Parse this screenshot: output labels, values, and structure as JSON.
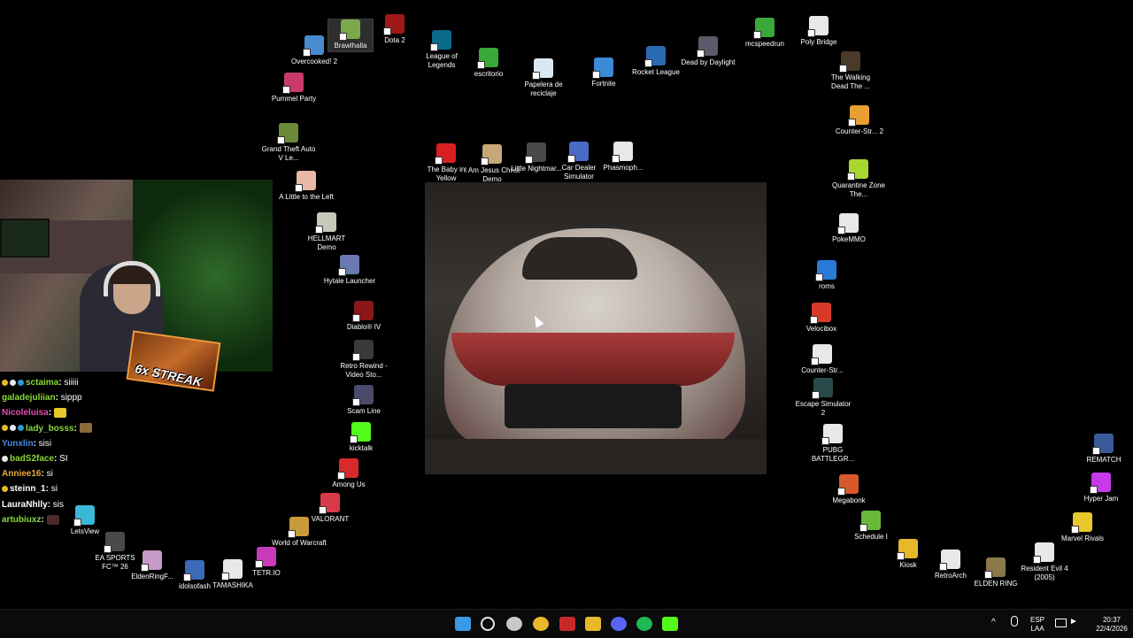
{
  "desktop_icons": [
    {
      "id": "overcooked",
      "label": "Overcooked! 2",
      "color": "#4a8bd0"
    },
    {
      "id": "brawlhalla",
      "label": "Brawlhalla",
      "color": "#7ba84a"
    },
    {
      "id": "dota2",
      "label": "Dota 2",
      "color": "#a01818"
    },
    {
      "id": "league",
      "label": "League of Legends",
      "color": "#0a6a8a"
    },
    {
      "id": "escritorio",
      "label": "escritorio",
      "color": "#3aa83a"
    },
    {
      "id": "papelera",
      "label": "Papelera de reciclaje",
      "color": "#d8e8f0"
    },
    {
      "id": "fortnite",
      "label": "Fortnite",
      "color": "#3a8ad8"
    },
    {
      "id": "rocket",
      "label": "Rocket League",
      "color": "#2a6ab0"
    },
    {
      "id": "dbd",
      "label": "Dead by Daylight",
      "color": "#5a5a6a"
    },
    {
      "id": "mcspeedrun",
      "label": "mcspeedrun",
      "color": "#3aa83a"
    },
    {
      "id": "polybridge",
      "label": "Poly Bridge",
      "color": "#e8e8e8"
    },
    {
      "id": "pummel",
      "label": "Pummel Party",
      "color": "#c83a6a"
    },
    {
      "id": "gta",
      "label": "Grand Theft Auto V Le...",
      "color": "#6a8a3a"
    },
    {
      "id": "walkingdead",
      "label": "The Walking Dead The ...",
      "color": "#4a3a2a"
    },
    {
      "id": "cs2",
      "label": "Counter-Str... 2",
      "color": "#e8a030"
    },
    {
      "id": "littleleft",
      "label": "A Little to the Left",
      "color": "#e8b8a8"
    },
    {
      "id": "babyyellow",
      "label": "The Baby in Yellow",
      "color": "#d82020"
    },
    {
      "id": "jesus",
      "label": "I Am Jesus Christ Demo",
      "color": "#c8a878"
    },
    {
      "id": "littlenightmares",
      "label": "Little Nightmar...",
      "color": "#4a4a4a"
    },
    {
      "id": "cardealer",
      "label": "Car Dealer Simulator",
      "color": "#4a6ac8"
    },
    {
      "id": "phasmo",
      "label": "Phasmoph...",
      "color": "#e8e8e8"
    },
    {
      "id": "quarantine",
      "label": "Quarantine Zone The...",
      "color": "#a8d830"
    },
    {
      "id": "hellmart",
      "label": "HELLMART Demo",
      "color": "#c8c8b8"
    },
    {
      "id": "pokemmo",
      "label": "PokeMMO",
      "color": "#e8e8e8"
    },
    {
      "id": "hytale",
      "label": "Hytale Launcher",
      "color": "#6a7ab0"
    },
    {
      "id": "roms",
      "label": "roms",
      "color": "#2a7ad8"
    },
    {
      "id": "diablo",
      "label": "Diablo® IV",
      "color": "#8a1818"
    },
    {
      "id": "velocibox",
      "label": "Velocibox",
      "color": "#d83a2a"
    },
    {
      "id": "retrorewind",
      "label": "Retro Rewind - Video Sto...",
      "color": "#3a3a3a"
    },
    {
      "id": "cs-go",
      "label": "Counter-Str...",
      "color": "#e8e8e8"
    },
    {
      "id": "escape",
      "label": "Escape Simulator 2",
      "color": "#2a4a4a"
    },
    {
      "id": "scamline",
      "label": "Scam Line",
      "color": "#4a4a6a"
    },
    {
      "id": "kicktalk",
      "label": "kicktalk",
      "color": "#53fc18"
    },
    {
      "id": "pubg",
      "label": "PUBG BATTLEGR...",
      "color": "#e8e8e8"
    },
    {
      "id": "rematch",
      "label": "REMATCH",
      "color": "#3a5a9a"
    },
    {
      "id": "amongus",
      "label": "Among Us",
      "color": "#d82a2a"
    },
    {
      "id": "megabonk",
      "label": "Megabonk",
      "color": "#d85a2a"
    },
    {
      "id": "hyperjam",
      "label": "Hyper Jam",
      "color": "#c83ae8"
    },
    {
      "id": "valorant",
      "label": "VALORANT",
      "color": "#d83a4a"
    },
    {
      "id": "schedule1",
      "label": "Schedule I",
      "color": "#6ab83a"
    },
    {
      "id": "marvel",
      "label": "Marvel Rivals",
      "color": "#e8c82a"
    },
    {
      "id": "letsview",
      "label": "LetsView",
      "color": "#3ab8d8"
    },
    {
      "id": "wow",
      "label": "World of Warcraft",
      "color": "#c89a3a"
    },
    {
      "id": "kiosk",
      "label": "Kiosk",
      "color": "#e8b82a"
    },
    {
      "id": "re4",
      "label": "Resident Evil 4 (2005)",
      "color": "#e8e8e8"
    },
    {
      "id": "fc26",
      "label": "EA SPORTS FC™ 26",
      "color": "#4a4a4a"
    },
    {
      "id": "tetrio",
      "label": "TETR.IO",
      "color": "#c83ab8"
    },
    {
      "id": "retroarch",
      "label": "RetroArch",
      "color": "#e8e8e8"
    },
    {
      "id": "eldenringf",
      "label": "EldenRingF...",
      "color": "#c89ac8"
    },
    {
      "id": "eldenring",
      "label": "ELDEN RING",
      "color": "#8a7a4a"
    },
    {
      "id": "idolsofash",
      "label": "idolsofash",
      "color": "#3a6ab8"
    },
    {
      "id": "tamashika",
      "label": "TAMASHIKA",
      "color": "#e8e8e8"
    }
  ],
  "overlay": {
    "streak_text": "6x STREAK"
  },
  "chat": [
    {
      "user": "sctaima",
      "msg": "siiiii",
      "color": "#8ad83a",
      "badges": [
        "#e8b82a",
        "#e8e8e8",
        "#2a9ad8"
      ]
    },
    {
      "user": "galadejuliian",
      "msg": "sippp",
      "color": "#8ad83a",
      "badges": []
    },
    {
      "user": "Nicoleluisa",
      "msg": "",
      "color": "#e84ab8",
      "badges": [],
      "emote": "#e8c82a"
    },
    {
      "user": "lady_bosss",
      "msg": "",
      "color": "#8ad83a",
      "badges": [
        "#e8b82a",
        "#e8e8e8",
        "#2a9ad8"
      ],
      "emote": "#8a6a3a"
    },
    {
      "user": "Yunxlin",
      "msg": "sisi",
      "color": "#4a8ae8",
      "badges": []
    },
    {
      "user": "badS2face",
      "msg": "SI",
      "color": "#8ad83a",
      "badges": [
        "#e8e8e8"
      ]
    },
    {
      "user": "Anniee16",
      "msg": "si",
      "color": "#e8a83a",
      "badges": []
    },
    {
      "user": "steinn_1",
      "msg": "si",
      "color": "#ffffff",
      "badges": [
        "#e8b82a"
      ]
    },
    {
      "user": "LauraNhlly",
      "msg": "sis",
      "color": "#ffffff",
      "badges": []
    },
    {
      "user": "artubiuxz",
      "msg": "",
      "color": "#8ad83a",
      "badges": [],
      "emote": "#4a2a2a"
    }
  ],
  "taskbar": {
    "buttons": [
      {
        "id": "start",
        "color": "#3a9ae8"
      },
      {
        "id": "search",
        "color": "#e8e8e8"
      },
      {
        "id": "obs",
        "color": "#c8c8c8"
      },
      {
        "id": "chrome",
        "color": "#e8b82a"
      },
      {
        "id": "studio",
        "color": "#c82a2a"
      },
      {
        "id": "explorer",
        "color": "#e8b82a"
      },
      {
        "id": "discord",
        "color": "#5865f2"
      },
      {
        "id": "spotify",
        "color": "#1db954"
      },
      {
        "id": "kick",
        "color": "#53fc18"
      }
    ],
    "language": "ESP",
    "layout": "LAA",
    "time": "20:37",
    "date": "22/4/2026"
  }
}
